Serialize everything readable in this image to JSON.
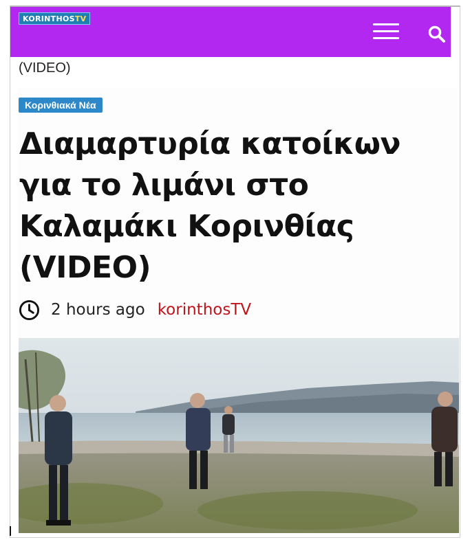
{
  "header": {
    "logo": {
      "text_main": "KORINTHOS",
      "text_accent": "TV"
    },
    "menu_icon": "hamburger-menu-icon",
    "search_icon": "search-icon",
    "background_color": "#b228f0"
  },
  "breadcrumb": {
    "text": "(VIDEO)"
  },
  "article": {
    "category": "Κορινθιακά Νέα",
    "title": "Διαμαρτυρία κατοίκων για το λιμάνι στο Καλαμάκι Κορινθίας (VIDEO)",
    "time_ago": "2 hours ago",
    "author": "korinthosTV",
    "clock_icon": "clock-icon",
    "image": "protest-residents-beach-photo"
  },
  "colors": {
    "badge": "#2d88c9",
    "author": "#c0141b",
    "header": "#b228f0"
  }
}
